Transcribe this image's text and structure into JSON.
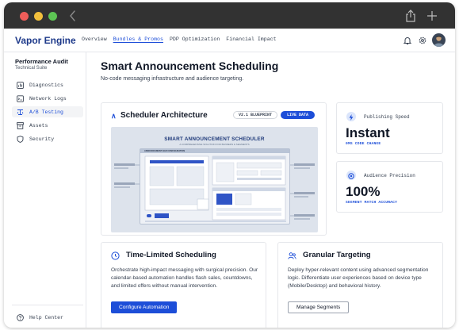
{
  "window": {
    "controls": [
      "close",
      "minimize",
      "zoom"
    ],
    "toolbar_icons": [
      "chevron-left-icon",
      "share-icon",
      "plus-icon"
    ]
  },
  "topnav": {
    "brand": "Vapor Engine",
    "links": [
      {
        "label": "Overview",
        "active": false
      },
      {
        "label": "Bundles & Promos",
        "active": true
      },
      {
        "label": "PDP Optimization",
        "active": false
      },
      {
        "label": "Financial Impact",
        "active": false
      }
    ],
    "icons": [
      "bell-icon",
      "gear-icon",
      "avatar"
    ]
  },
  "sidebar": {
    "title": "Performance Audit",
    "subtitle": "Technical Suite",
    "items": [
      {
        "label": "Diagnostics",
        "icon": "diagnostics-icon",
        "active": false
      },
      {
        "label": "Network Logs",
        "icon": "terminal-icon",
        "active": false
      },
      {
        "label": "A/B Testing",
        "icon": "ab-testing-icon",
        "active": true
      },
      {
        "label": "Assets",
        "icon": "assets-icon",
        "active": false
      },
      {
        "label": "Security",
        "icon": "shield-icon",
        "active": false
      }
    ],
    "help": {
      "label": "Help Center",
      "icon": "help-icon"
    }
  },
  "main": {
    "title": "Smart Announcement Scheduling",
    "subtitle": "No-code messaging infrastructure and audience targeting.",
    "architecture": {
      "title": "Scheduler Architecture",
      "badge_version": "V2.1 BLUEPRINT",
      "badge_status": "LIVE DATA",
      "diagram": {
        "title": "SMART ANNOUNCEMENT SCHEDULER",
        "subtitle": "A COMPREHENSIVE SOLUTION FOR BANNERS & SEGMENTS",
        "frame_label": "ANNOUNCEMENT BAR CONFIGURATION"
      }
    },
    "metrics": [
      {
        "label": "Publishing Speed",
        "value": "Instant",
        "sub": "0MS CODE CHANGE",
        "icon": "lightning-icon"
      },
      {
        "label": "Audience Precision",
        "value": "100%",
        "sub": "SEGMENT MATCH ACCURACY",
        "icon": "target-icon"
      }
    ],
    "features": [
      {
        "title": "Time-Limited Scheduling",
        "icon": "clock-icon",
        "body": "Orchestrate high-impact messaging with surgical precision. Our calendar-based automation handles flash sales, countdowns, and limited offers without manual intervention.",
        "button": "Configure Automation"
      },
      {
        "title": "Granular Targeting",
        "icon": "users-icon",
        "body": "Deploy hyper-relevant content using advanced segmentation logic. Differentiate user experiences based on device type (Mobile/Desktop) and behavioral history.",
        "button": "Manage Segments"
      }
    ]
  },
  "colors": {
    "accent": "#1d4ed8",
    "brand": "#1e3a8a",
    "titlebar": "#323232",
    "traffic_red": "#ee5d59",
    "traffic_yellow": "#f2bf3c",
    "traffic_green": "#5dc454"
  }
}
